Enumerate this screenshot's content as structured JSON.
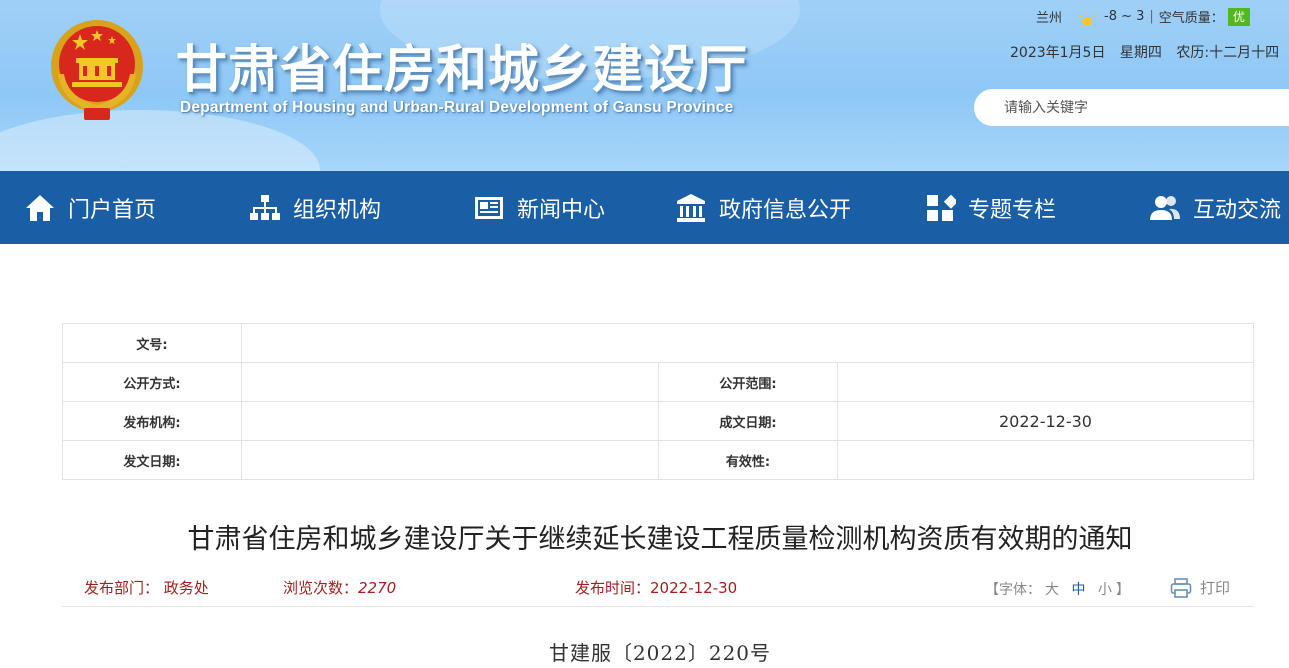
{
  "header": {
    "title": "甘肃省住房和城乡建设厅",
    "subtitle": "Department of Housing and Urban-Rural Development of Gansu Province",
    "weather": {
      "city": "兰州",
      "temperature": "-8 ~ 3",
      "separator": "|",
      "air_quality_label": "空气质量：",
      "air_quality_value": "优"
    },
    "date": {
      "gregorian": "2023年1月5日",
      "weekday": "星期四",
      "lunar": "农历:十二月十四"
    },
    "search": {
      "placeholder": "请输入关键字"
    }
  },
  "nav": {
    "items": [
      {
        "label": "门户首页",
        "icon": "home-icon"
      },
      {
        "label": "组织机构",
        "icon": "org-chart-icon"
      },
      {
        "label": "新闻中心",
        "icon": "news-icon"
      },
      {
        "label": "政府信息公开",
        "icon": "government-building-icon"
      },
      {
        "label": "专题专栏",
        "icon": "grid-squares-icon"
      },
      {
        "label": "互动交流",
        "icon": "users-icon"
      }
    ]
  },
  "info": {
    "doc_no_label": "文号:",
    "doc_no_value": "",
    "public_mode_label": "公开方式:",
    "public_mode_value": "",
    "public_scope_label": "公开范围:",
    "public_scope_value": "",
    "publisher_label": "发布机构:",
    "publisher_value": "",
    "written_date_label": "成文日期:",
    "written_date_value": "2022-12-30",
    "issue_date_label": "发文日期:",
    "issue_date_value": "",
    "validity_label": "有效性:",
    "validity_value": ""
  },
  "article": {
    "title": "甘肃省住房和城乡建设厅关于继续延长建设工程质量检测机构资质有效期的通知",
    "dept_label": "发布部门：",
    "dept_value": "政务处",
    "views_label": "浏览次数：",
    "views_value": "2270",
    "time_label": "发布时间：",
    "time_value": "2022-12-30",
    "font": {
      "open": "【",
      "label": "字体：",
      "large": "大",
      "medium": "中",
      "small": "小",
      "close": "】"
    },
    "print_label": "打印",
    "doc_number": "甘建服〔2022〕220号"
  },
  "colors": {
    "nav_bg": "#1a5ea6",
    "meta_red": "#a01f1f",
    "aq_green": "#53b81e",
    "header_sky": "#8ec8f6"
  }
}
